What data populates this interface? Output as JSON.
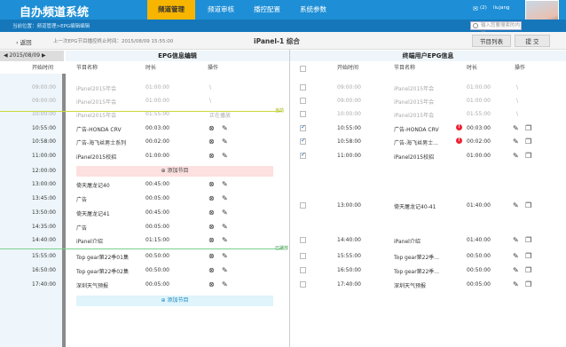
{
  "app": {
    "title": "自办频道系统"
  },
  "nav": [
    "频道管理",
    "频道审核",
    "播控配置",
    "系统参数"
  ],
  "header": {
    "mail_count": "(2)",
    "username": "liujang",
    "search_placeholder": "输入您要搜索的内容"
  },
  "breadcrumb": "当前位置：频道管理>EPG编辑编辑",
  "toolbar": {
    "back": "返回",
    "last_sync": "上一次EPG节目播控终止时间：2015/08/09  15:55:00",
    "title": "iPanel-1 综合",
    "program_list": "节目列表",
    "submit": "提 交"
  },
  "date": "◀ 2015/08/09 ▶",
  "sections": {
    "left": "EPG信息编辑",
    "right": "终端用户EPG信息"
  },
  "columns": {
    "left": [
      "开始时间",
      "节目名称",
      "时长",
      "操作"
    ],
    "right": [
      "开始时间",
      "节目名称",
      "时长",
      "操作"
    ]
  },
  "markers": {
    "now": "当前",
    "live": "已播放"
  },
  "add_program": "添加节目",
  "left_rows": [
    {
      "time": "09:00:00",
      "name": "iPanel2015年会",
      "dur": "01:00:00",
      "op": "\\",
      "state": "past"
    },
    {
      "time": "09:00:00",
      "name": "iPanel2015年会",
      "dur": "01:00:00",
      "op": "\\",
      "state": "past"
    },
    {
      "time": "10:00:00",
      "name": "iPanel2015年会",
      "dur": "01:55:00",
      "op": "正在播放",
      "state": "past"
    },
    {
      "time": "10:55:00",
      "name": "广告-HONDA CRV",
      "dur": "00:03:00",
      "state": "edit"
    },
    {
      "time": "10:58:00",
      "name": "广告-海飞丝男士系列",
      "dur": "00:02:00",
      "state": "edit"
    },
    {
      "time": "11:00:00",
      "name": "iPanel2015校招",
      "dur": "01:00:00",
      "state": "edit"
    },
    {
      "time": "12:00:00",
      "name": "",
      "dur": "",
      "state": "add"
    },
    {
      "time": "13:00:00",
      "name": "倚天屠龙记40",
      "dur": "00:45:00",
      "state": "edit"
    },
    {
      "time": "13:45:00",
      "name": "广告",
      "dur": "00:05:00",
      "state": "edit"
    },
    {
      "time": "13:50:00",
      "name": "倚天屠龙记41",
      "dur": "00:45:00",
      "state": "edit"
    },
    {
      "time": "14:35:00",
      "name": "广告",
      "dur": "00:05:00",
      "state": "edit"
    },
    {
      "time": "14:40:00",
      "name": "iPanel介绍",
      "dur": "01:15:00",
      "state": "edit"
    },
    {
      "time": "15:55:00",
      "name": "Top gear第22季01集",
      "dur": "00:50:00",
      "state": "edit"
    },
    {
      "time": "16:50:00",
      "name": "Top gear第22季02集",
      "dur": "00:50:00",
      "state": "edit"
    },
    {
      "time": "17:40:00",
      "name": "深圳天气预报",
      "dur": "00:05:00",
      "state": "edit"
    }
  ],
  "right_rows": [
    {
      "time": "09:00:00",
      "name": "iPanel2015年会",
      "dur": "01:00:00",
      "op": "\\",
      "state": "past"
    },
    {
      "time": "09:00:00",
      "name": "iPanel2015年会",
      "dur": "01:00:00",
      "op": "\\",
      "state": "past"
    },
    {
      "time": "10:00:00",
      "name": "iPanel2015年会",
      "dur": "01:55:00",
      "op": "\\",
      "state": "past"
    },
    {
      "time": "10:55:00",
      "name": "广告-HONDA CRV",
      "dur": "00:03:00",
      "state": "checked",
      "alert": "!"
    },
    {
      "time": "10:58:00",
      "name": "广告-海飞丝男士...",
      "dur": "00:02:00",
      "state": "checked",
      "alert": "!"
    },
    {
      "time": "11:00:00",
      "name": "iPanel2015校招",
      "dur": "01:00:00",
      "state": "checked"
    },
    {
      "time": "13:00:00",
      "name": "倚天屠龙记40-41",
      "dur": "01:40:00",
      "state": "merged"
    },
    {
      "time": "14:40:00",
      "name": "iPanel介绍",
      "dur": "01:40:00",
      "state": "normal"
    },
    {
      "time": "15:55:00",
      "name": "Top gear第22季...",
      "dur": "00:50:00",
      "state": "normal"
    },
    {
      "time": "16:50:00",
      "name": "Top gear第22季...",
      "dur": "00:50:00",
      "state": "normal"
    },
    {
      "time": "17:40:00",
      "name": "深圳天气预报",
      "dur": "00:05:00",
      "state": "normal"
    }
  ]
}
